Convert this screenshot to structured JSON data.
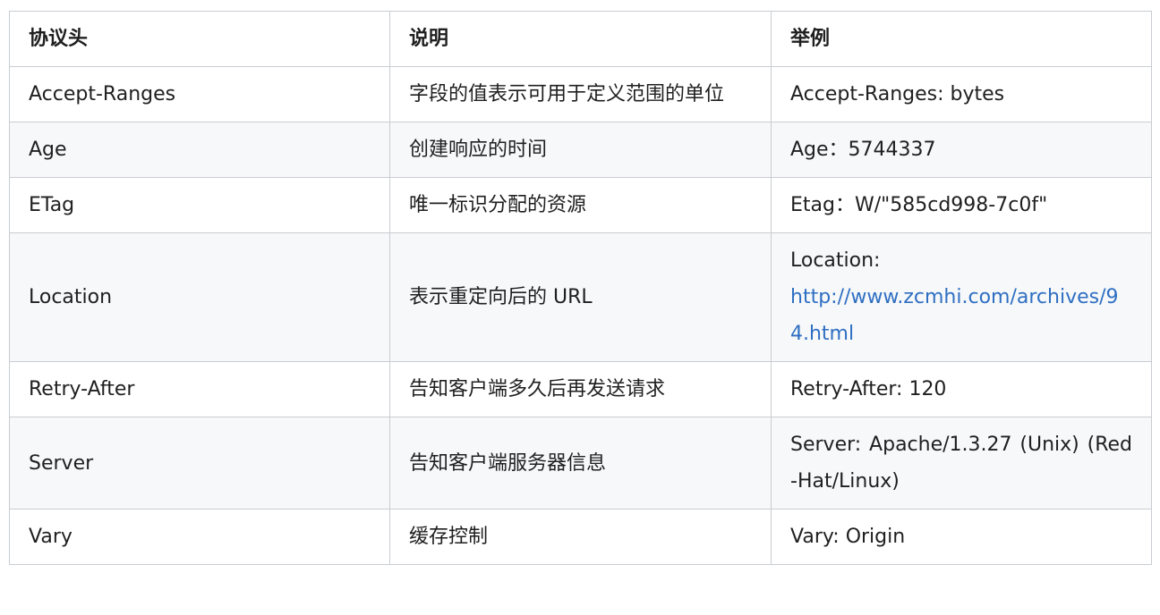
{
  "table": {
    "headers": [
      "协议头",
      "说明",
      "举例"
    ],
    "rows": [
      {
        "header": "Accept-Ranges",
        "desc": "字段的值表示可用于定义范围的单位",
        "example": "Accept-Ranges: bytes"
      },
      {
        "header": "Age",
        "desc": "创建响应的时间",
        "example": "Age：5744337"
      },
      {
        "header": "ETag",
        "desc": "唯一标识分配的资源",
        "example": "Etag：W/\"585cd998-7c0f\""
      },
      {
        "header": "Location",
        "desc": "表示重定向后的 URL",
        "example_prefix": "Location:",
        "example_link": "http://www.zcmhi.com/archives/94.html"
      },
      {
        "header": "Retry-After",
        "desc": "告知客户端多久后再发送请求",
        "example": "Retry-After: 120"
      },
      {
        "header": "Server",
        "desc": "告知客户端服务器信息",
        "example": "Server: Apache/1.3.27 (Unix) (Red-Hat/Linux)"
      },
      {
        "header": "Vary",
        "desc": "缓存控制",
        "example": "Vary: Origin"
      }
    ]
  },
  "colors": {
    "border": "#c9ccd1",
    "stripe": "#f6f8fa",
    "link": "#2f6fc2",
    "text": "#1f1f1f"
  }
}
